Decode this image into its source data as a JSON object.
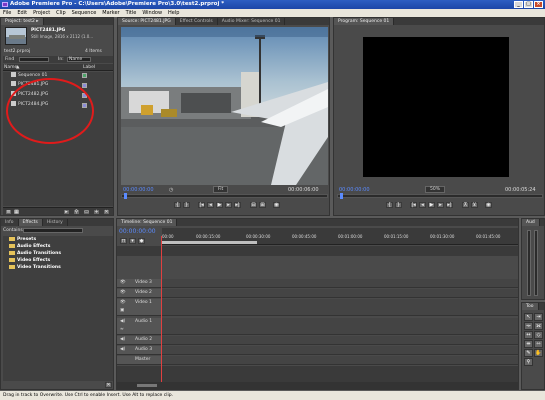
{
  "window": {
    "title": "Adobe Premiere Pro - C:\\Users\\Adobe\\Premiere Pro\\3.0\\test2.prproj *"
  },
  "menu": [
    "File",
    "Edit",
    "Project",
    "Clip",
    "Sequence",
    "Marker",
    "Title",
    "Window",
    "Help"
  ],
  "project": {
    "tab": "Project: test2 ▸",
    "clip_name": "PICT2481.JPG",
    "clip_info": "Still Image, 2816 x 2112 (1.0...",
    "file": "test2.prproj",
    "item_count": "4 Items",
    "find_label": "Find",
    "in_label": "In:",
    "in_value": "Name",
    "col_name": "Name",
    "col_label": "Label",
    "items": [
      "Sequence 01",
      "PICT2481.JPG",
      "PICT2482.JPG",
      "PICT2484.JPG"
    ]
  },
  "source": {
    "tabs": [
      "Source: PICT2481.JPG",
      "Effect Controls",
      "Audio Mixer: Sequence 01"
    ],
    "tc_in": "00:00:00:00",
    "fit": "Fit",
    "tc_out": "00:00:06:00"
  },
  "program": {
    "tab": "Program: Sequence 01",
    "tc_in": "00:00:00:00",
    "zoom": "50%",
    "tc_out": "00:00:05:24"
  },
  "effects": {
    "tabs": [
      "Info",
      "Effects",
      "History"
    ],
    "contains_label": "Contains:",
    "folders": [
      "Presets",
      "Audio Effects",
      "Audio Transitions",
      "Video Effects",
      "Video Transitions"
    ]
  },
  "timeline": {
    "tab": "Timeline: Sequence 01",
    "tc": "00:00:00:00",
    "ruler": [
      "00:00",
      "00:00:15:00",
      "00:00:30:00",
      "00:00:45:00",
      "00:01:00:00",
      "00:01:15:00",
      "00:01:30:00",
      "00:01:45:00"
    ],
    "video_tracks": [
      "Video 3",
      "Video 2",
      "Video 1"
    ],
    "audio_tracks": [
      "Audio 1",
      "Audio 2",
      "Audio 3",
      "Master"
    ]
  },
  "audio_meter": {
    "tab": "Aud"
  },
  "tools": {
    "tab": "Too"
  },
  "status": {
    "text": "Drag in track to Overwrite. Use Ctrl to enable Insert. Use Alt to replace clip."
  },
  "colors": {
    "timecode": "#5b8bff",
    "highlight_circle": "#e01b1b",
    "label_lavender": "#8c8cd8"
  }
}
